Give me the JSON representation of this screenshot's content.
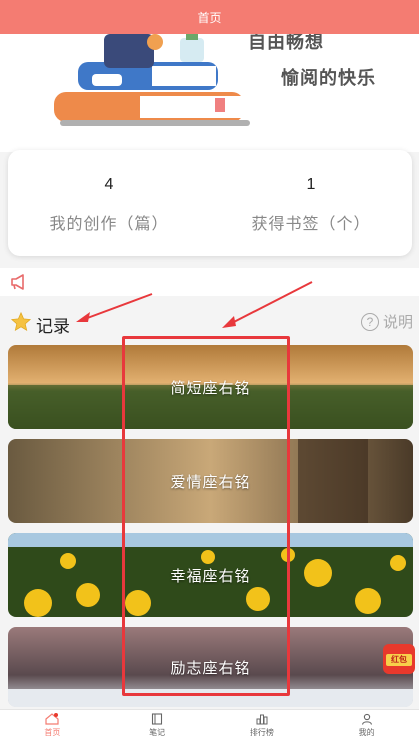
{
  "topbar": {
    "title": "首页"
  },
  "hero": {
    "slogan_line1": "自由畅想",
    "slogan_line2": "愉阅的快乐"
  },
  "stats": [
    {
      "value": "4",
      "label": "我的创作（篇）"
    },
    {
      "value": "1",
      "label": "获得书签（个）"
    }
  ],
  "notice": {
    "text": ""
  },
  "section": {
    "title": "记录",
    "help_label": "说明"
  },
  "cards": [
    {
      "label": "简短座右铭"
    },
    {
      "label": "爱情座右铭"
    },
    {
      "label": "幸福座右铭"
    },
    {
      "label": "励志座右铭"
    }
  ],
  "tabs": [
    {
      "label": "首页",
      "icon": "home-icon"
    },
    {
      "label": "笔记",
      "icon": "note-icon"
    },
    {
      "label": "排行榜",
      "icon": "ranking-icon"
    },
    {
      "label": "我的",
      "icon": "user-icon"
    }
  ],
  "float": {
    "text": "红包"
  },
  "colors": {
    "brand": "#f47c72",
    "annotation": "#e8383c"
  }
}
